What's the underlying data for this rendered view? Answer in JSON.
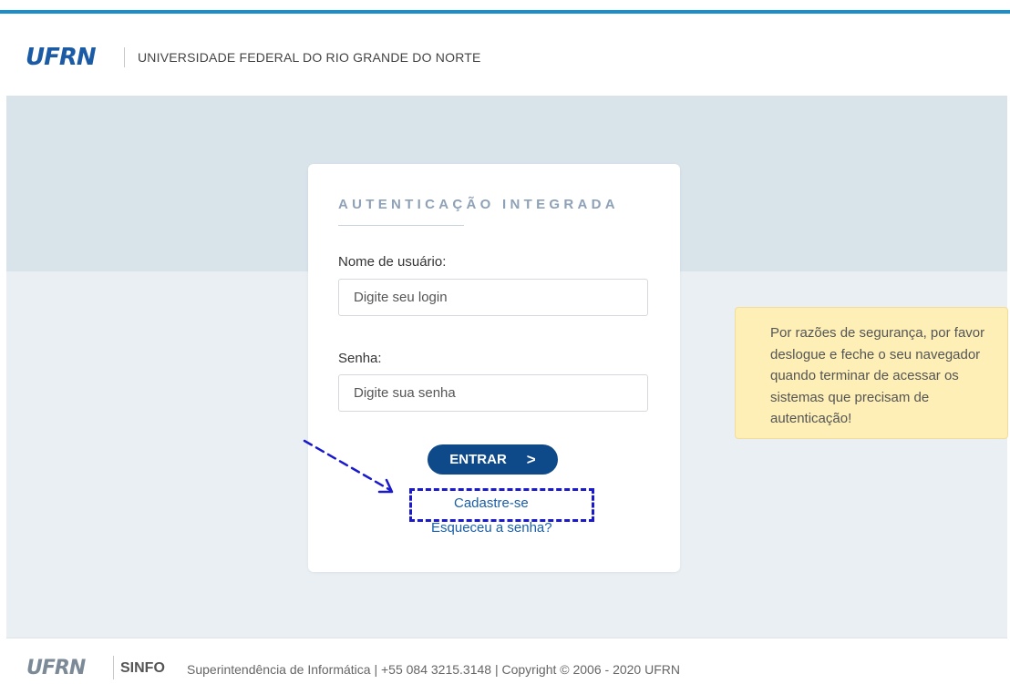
{
  "header": {
    "logo_text": "UFRN",
    "title": "UNIVERSIDADE FEDERAL DO RIO GRANDE DO NORTE"
  },
  "login": {
    "title": "AUTENTICAÇÃO INTEGRADA",
    "username_label": "Nome de usuário:",
    "username_placeholder": "Digite seu login",
    "username_value": "",
    "password_label": "Senha:",
    "password_placeholder": "Digite sua senha",
    "password_value": "",
    "submit_label": "ENTRAR",
    "submit_icon": ">",
    "register_link": "Cadastre-se",
    "forgot_link": "Esqueceu a senha?"
  },
  "notice": {
    "text": "Por razões de segurança, por favor deslogue e feche o seu navegador quando terminar de acessar os sistemas que precisam de autenticação!"
  },
  "footer": {
    "logo_text": "UFRN",
    "unit": "SINFO",
    "text": "Superintendência de Informática | +55 084 3215.3148 | Copyright © 2006 - 2020 UFRN"
  },
  "colors": {
    "accent_line": "#1a8fcb",
    "brand_blue": "#0e4a8a",
    "link_blue": "#1a5fa8",
    "annotation_blue": "#1a1acc",
    "notice_bg": "#fdefb6"
  }
}
